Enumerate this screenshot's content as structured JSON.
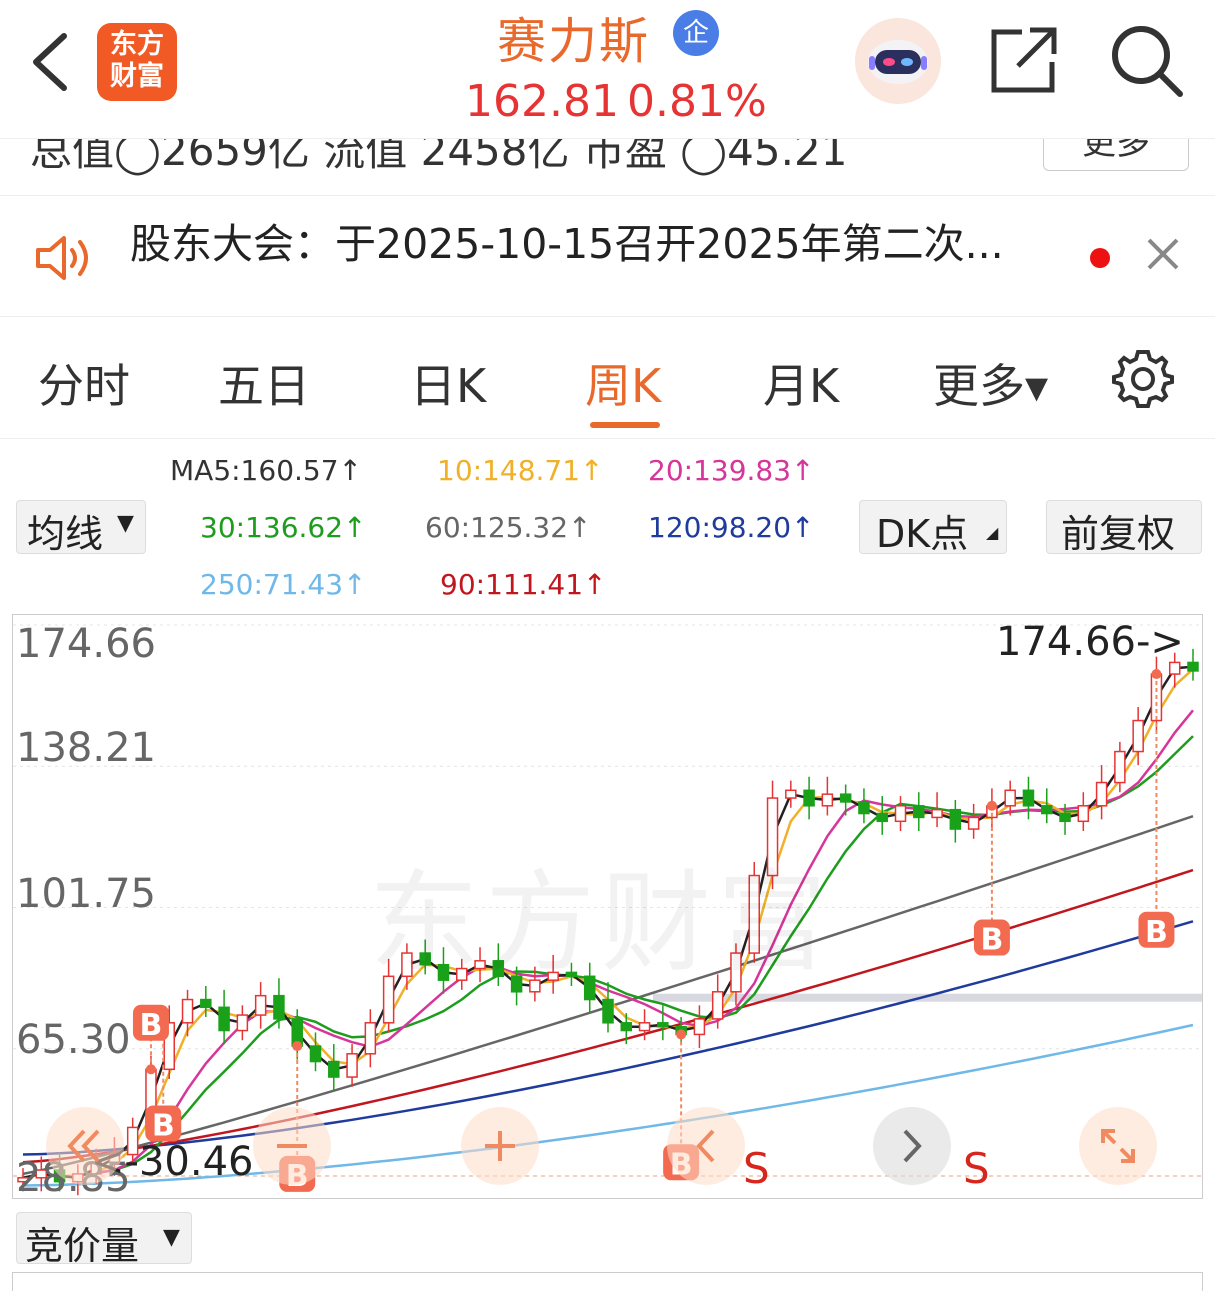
{
  "header": {
    "logo_line1": "东方",
    "logo_line2": "财富",
    "stock_name": "赛力斯",
    "badge": "企",
    "price": "162.81",
    "change_pct": "0.81%"
  },
  "summary_strip": {
    "text": "总值◯2659亿  流值 2458亿  市盈  ◯45.21",
    "more_label": "更多"
  },
  "notice": {
    "text": "股东大会：于2025-10-15召开2025年第二次..."
  },
  "tabs": [
    {
      "label": "分时"
    },
    {
      "label": "五日"
    },
    {
      "label": "日K"
    },
    {
      "label": "周K"
    },
    {
      "label": "月K"
    },
    {
      "label": "更多▾"
    }
  ],
  "active_tab": "周K",
  "indicators": {
    "ma_selector": "均线",
    "dk_button": "DK点",
    "restore_button": "前复权",
    "ma5": "MA5:160.57↑",
    "ma10": "10:148.71↑",
    "ma20": "20:139.83↑",
    "ma30": "30:136.62↑",
    "ma60": "60:125.32↑",
    "ma120": "120:98.20↑",
    "ma250": "250:71.43↑",
    "ma90": "90:111.41↑"
  },
  "colors": {
    "accent": "#e9692c",
    "up": "#e63333",
    "down": "#1aa11a",
    "ma5": "#222222",
    "ma10": "#f0b02a",
    "ma20": "#d6359a",
    "ma30": "#1e9c1e",
    "ma60": "#666666",
    "ma120": "#1f3b9c",
    "ma250": "#6fb8e8",
    "ma90": "#c0171f"
  },
  "chart": {
    "y_labels": [
      "174.66",
      "138.21",
      "101.75",
      "65.30"
    ],
    "max_label": "174.66->",
    "min_label": "28.85",
    "low_marker": "<-30.46",
    "watermark": "东方财富",
    "signals": [
      "B",
      "B",
      "B",
      "B",
      "B",
      "B",
      "S",
      "S"
    ]
  },
  "chart_data": {
    "type": "candlestick",
    "timeframe": "周K",
    "ylim": [
      28.85,
      174.66
    ],
    "y_ticks": [
      174.66,
      138.21,
      101.75,
      65.3
    ],
    "max_price": 174.66,
    "low_price": 30.46,
    "last_close": 162.81,
    "moving_averages": [
      {
        "name": "MA5",
        "value": 160.57
      },
      {
        "name": "10",
        "value": 148.71
      },
      {
        "name": "20",
        "value": 139.83
      },
      {
        "name": "30",
        "value": 136.62
      },
      {
        "name": "60",
        "value": 125.32
      },
      {
        "name": "120",
        "value": 98.2
      },
      {
        "name": "250",
        "value": 71.43
      },
      {
        "name": "90",
        "value": 111.41
      }
    ],
    "series_approx_close": [
      32,
      34,
      31,
      33,
      36,
      38,
      45,
      60,
      72,
      78,
      76,
      70,
      74,
      79,
      73,
      66,
      62,
      58,
      64,
      72,
      84,
      90,
      87,
      83,
      86,
      88,
      84,
      80,
      83,
      85,
      84,
      78,
      72,
      70,
      72,
      71,
      69,
      73,
      80,
      90,
      110,
      130,
      132,
      128,
      131,
      129,
      126,
      124,
      128,
      125,
      127,
      122,
      125,
      128,
      132,
      128,
      126,
      124,
      128,
      134,
      142,
      150,
      162,
      165,
      162.81
    ]
  },
  "volume_selector": "竞价量"
}
